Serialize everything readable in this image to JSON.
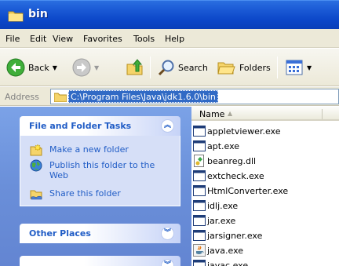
{
  "window": {
    "title": "bin"
  },
  "menu": [
    "File",
    "Edit",
    "View",
    "Favorites",
    "Tools",
    "Help"
  ],
  "toolbar": {
    "back_label": "Back",
    "search_label": "Search",
    "folders_label": "Folders"
  },
  "address": {
    "label": "Address",
    "path": "C:\\Program Files\\Java\\jdk1.6.0\\bin"
  },
  "tasks_panel": {
    "title": "File and Folder Tasks",
    "items": [
      {
        "label": "Make a new folder",
        "icon": "new-folder-icon"
      },
      {
        "label": "Publish this folder to the Web",
        "icon": "globe-icon"
      },
      {
        "label": "Share this folder",
        "icon": "share-folder-icon"
      }
    ]
  },
  "other_places_panel": {
    "title": "Other Places"
  },
  "file_list": {
    "column_name": "Name",
    "files": [
      {
        "name": "appletviewer.exe",
        "icon": "exe-window-icon"
      },
      {
        "name": "apt.exe",
        "icon": "exe-window-icon"
      },
      {
        "name": "beanreg.dll",
        "icon": "dll-icon"
      },
      {
        "name": "extcheck.exe",
        "icon": "exe-window-icon"
      },
      {
        "name": "HtmlConverter.exe",
        "icon": "exe-window-icon"
      },
      {
        "name": "idlj.exe",
        "icon": "exe-window-icon"
      },
      {
        "name": "jar.exe",
        "icon": "exe-window-icon"
      },
      {
        "name": "jarsigner.exe",
        "icon": "exe-window-icon"
      },
      {
        "name": "java.exe",
        "icon": "java-icon"
      },
      {
        "name": "javac.exe",
        "icon": "exe-window-icon"
      }
    ]
  },
  "colors": {
    "titlebar": "#0b46c8",
    "task_link": "#215dc6",
    "selection": "#316ac5"
  }
}
